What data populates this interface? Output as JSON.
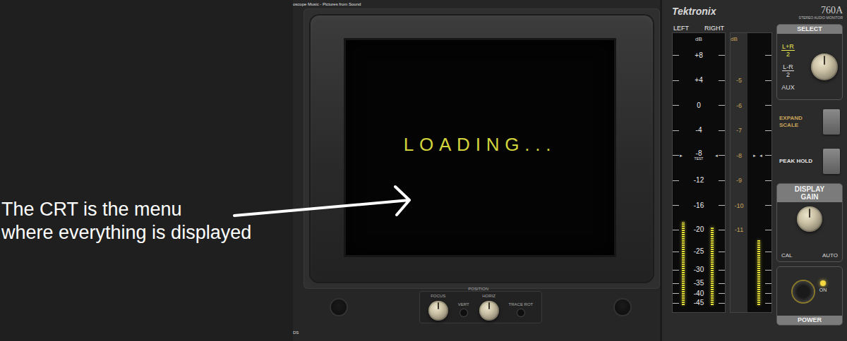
{
  "window": {
    "title": "oscope Music - Pictures from Sound"
  },
  "annotation": {
    "lines": [
      "The CRT is the menu",
      "where everything is displayed"
    ]
  },
  "screen": {
    "text": "LOADING..."
  },
  "front_controls": {
    "focus": "FOCUS",
    "position": "POSITION",
    "vert": "VERT",
    "horiz": "HORIZ",
    "trace": "TRACE ROT"
  },
  "footer": "DS",
  "brand": {
    "name": "Tektronix",
    "model": "760A",
    "subtitle": "STEREO AUDIO MONITOR"
  },
  "level_meter": {
    "channels": [
      {
        "name": "LEFT",
        "level": 0.32
      },
      {
        "name": "RIGHT",
        "level": 0.3
      }
    ],
    "unit": "dB",
    "scale": [
      {
        "label": "+8"
      },
      {
        "label": "+4"
      },
      {
        "label": "0"
      },
      {
        "label": "-4"
      },
      {
        "label": "-8",
        "sub": "TEST",
        "markers": [
          "►",
          "◄"
        ]
      },
      {
        "label": "-12"
      },
      {
        "label": "-16"
      },
      {
        "label": "-20"
      },
      {
        "label": "-25"
      },
      {
        "label": "-30"
      },
      {
        "label": "-35"
      },
      {
        "label": "-40"
      },
      {
        "label": "-45"
      }
    ]
  },
  "difference_meter": {
    "unit": "dB",
    "scale": [
      {
        "label": "-5"
      },
      {
        "label": "-6"
      },
      {
        "label": "-7"
      },
      {
        "label": "-8",
        "markers": [
          "►",
          "◄"
        ]
      },
      {
        "label": "-9"
      },
      {
        "label": "-10"
      },
      {
        "label": "-11"
      }
    ],
    "level": 0.25
  },
  "select": {
    "title": "SELECT",
    "options": [
      {
        "label": "L+R",
        "denominator": "2",
        "selected": true
      },
      {
        "label": "L-R",
        "denominator": "2",
        "selected": false
      },
      {
        "label": "AUX",
        "selected": false
      }
    ]
  },
  "buttons": [
    {
      "label": "EXPAND SCALE",
      "on": false,
      "color": "#c9a35a"
    },
    {
      "label": "PEAK HOLD",
      "on": false,
      "color": "#e6e6e6"
    }
  ],
  "display_gain": {
    "title": "DISPLAY GAIN",
    "options": [
      "CAL",
      "AUTO"
    ]
  },
  "power": {
    "title": "POWER",
    "indicator": "ON",
    "on": true
  }
}
